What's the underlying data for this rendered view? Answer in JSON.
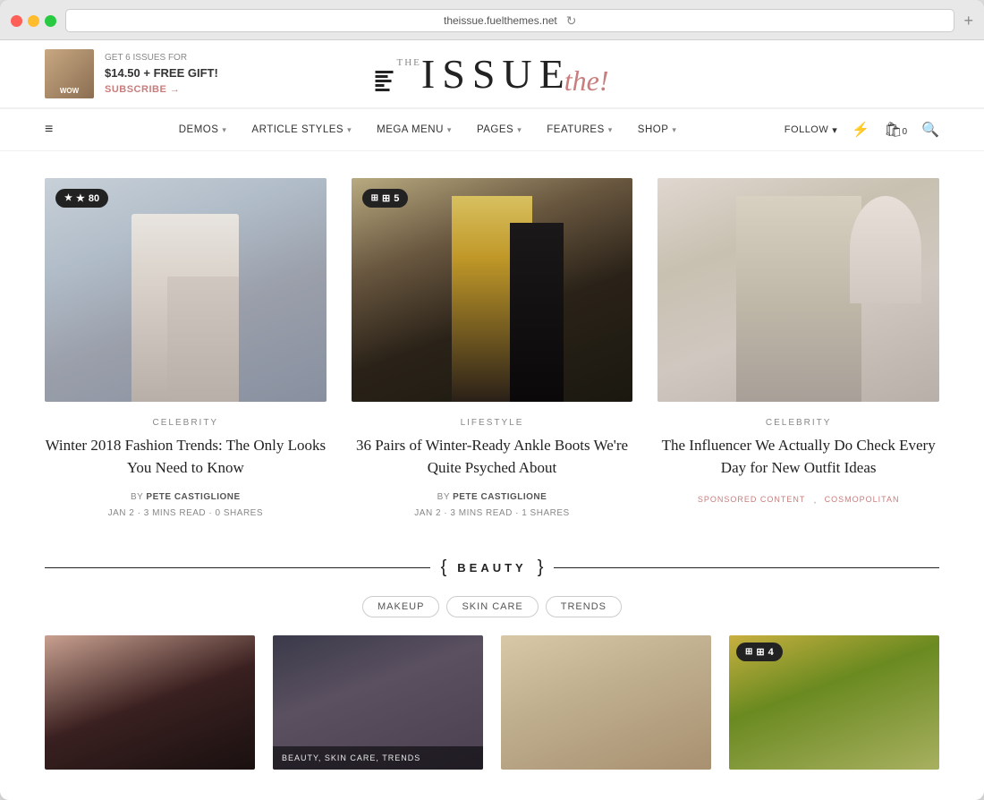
{
  "browser": {
    "url": "theissue.fuelthemes.net",
    "new_tab_icon": "+"
  },
  "banner": {
    "issues_label": "GET 6 ISSUES FOR",
    "price": "$14.50 + FREE GIFT!",
    "subscribe_label": "SUBSCRIBE →"
  },
  "logo": {
    "main": "ISSUE",
    "script": "the",
    "sub": "THE ISSUE"
  },
  "nav": {
    "items": [
      {
        "label": "DEMOS",
        "has_dropdown": true
      },
      {
        "label": "ARTICLE STYLES",
        "has_dropdown": true
      },
      {
        "label": "MEGA MENU",
        "has_dropdown": true
      },
      {
        "label": "PAGES",
        "has_dropdown": true
      },
      {
        "label": "FEATURES",
        "has_dropdown": true
      },
      {
        "label": "SHOP",
        "has_dropdown": true
      }
    ],
    "right_items": [
      {
        "label": "FOLLOW",
        "has_dropdown": true
      }
    ],
    "cart_count": "0"
  },
  "articles": [
    {
      "category": "CELEBRITY",
      "title": "Winter 2018 Fashion Trends: The Only Looks You Need to Know",
      "author": "PETE CASTIGLIONE",
      "date": "JAN 2",
      "read_time": "3 MINS READ",
      "shares": "0 SHARES",
      "badge_type": "star",
      "badge_value": "80",
      "img_class": "img-fashion1"
    },
    {
      "category": "LIFESTYLE",
      "title": "36 Pairs of Winter-Ready Ankle Boots We're Quite Psyched About",
      "author": "PETE CASTIGLIONE",
      "date": "JAN 2",
      "read_time": "3 MINS READ",
      "shares": "1 SHARES",
      "badge_type": "gallery",
      "badge_value": "5",
      "img_class": "img-boots"
    },
    {
      "category": "CELEBRITY",
      "title": "The Influencer We Actually Do Check Every Day for New Outfit Ideas",
      "author": null,
      "tags": [
        "SPONSORED CONTENT",
        "COSMOPOLITAN"
      ],
      "badge_type": null,
      "img_class": "img-influencer"
    }
  ],
  "beauty_section": {
    "title": "BEAUTY",
    "tabs": [
      "MAKEUP",
      "SKIN CARE",
      "TRENDS"
    ],
    "cards": [
      {
        "img_class": "img-beauty1",
        "overlay": null
      },
      {
        "img_class": "img-beauty2",
        "overlay": "BEAUTY, SKIN CARE, TRENDS"
      },
      {
        "img_class": "img-beauty3",
        "overlay": null
      },
      {
        "img_class": "img-beauty4",
        "badge": "4",
        "overlay": null
      }
    ]
  },
  "icons": {
    "hamburger": "≡",
    "chevron": "▾",
    "lightning": "⚡",
    "cart": "🛍",
    "search": "🔍"
  }
}
